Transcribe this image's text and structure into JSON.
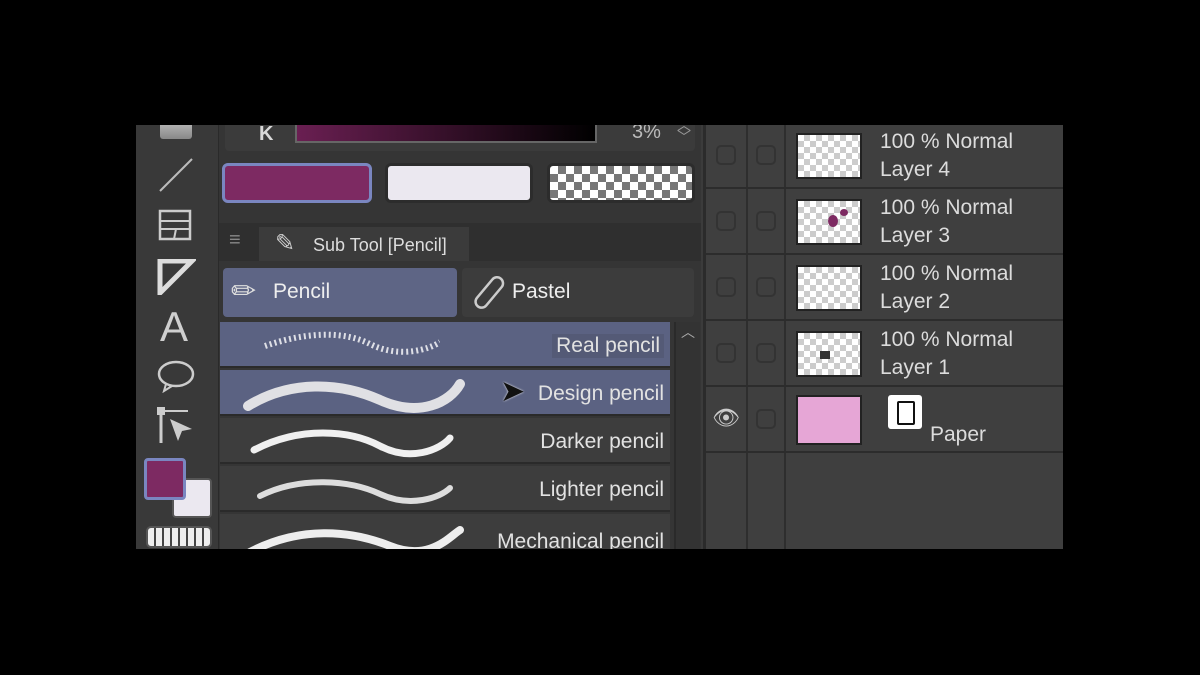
{
  "color_bar": {
    "channel": "K",
    "value": "3%"
  },
  "colors": {
    "main": "#7d2a62",
    "sub": "#ebe8f0",
    "transparent": "checker",
    "accent": "#5b6282",
    "paper": "#e6a6d6"
  },
  "subtool": {
    "tab_label": "Sub Tool [Pencil]",
    "groups": [
      {
        "label": "Pencil",
        "icon": "pencil-icon",
        "selected": true
      },
      {
        "label": "Pastel",
        "icon": "pastel-icon",
        "selected": false
      }
    ],
    "items": [
      {
        "label": "Real pencil",
        "selected": true
      },
      {
        "label": "Design pencil",
        "selected": true
      },
      {
        "label": "Darker pencil"
      },
      {
        "label": "Lighter pencil"
      },
      {
        "label": "Mechanical pencil"
      }
    ]
  },
  "layers": [
    {
      "mode": "100 % Normal",
      "name": "Layer 4"
    },
    {
      "mode": "100 % Normal",
      "name": "Layer 3"
    },
    {
      "mode": "100 % Normal",
      "name": "Layer 2"
    },
    {
      "mode": "100 % Normal",
      "name": "Layer 1"
    },
    {
      "mode": "",
      "name": "Paper",
      "visible": true
    }
  ],
  "toolbar_icons": [
    "gradient-icon",
    "line-icon",
    "frame-border-icon",
    "ruler-icon",
    "text-icon",
    "balloon-icon",
    "correct-line-icon",
    "color-swatch-icon",
    "pattern-icon"
  ]
}
